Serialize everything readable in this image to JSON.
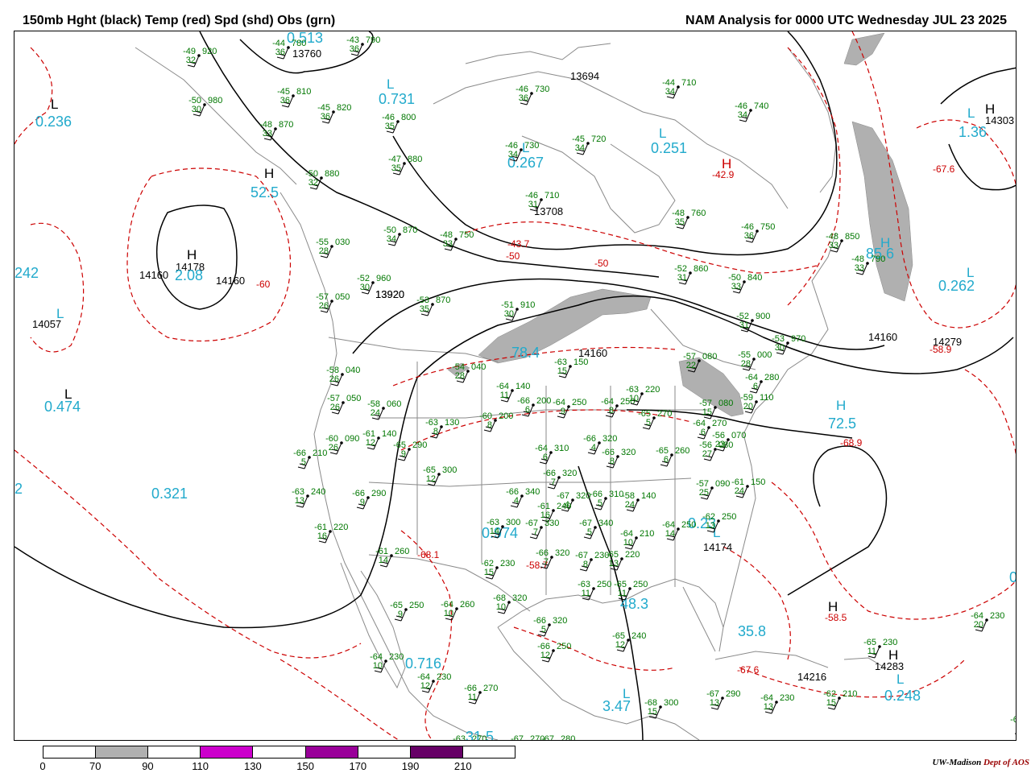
{
  "header": {
    "left_title": "150mb Hght (black) Temp (red) Spd (shd) Obs (grn)",
    "right_title": "NAM Analysis for 0000 UTC Wednesday  JUL 23 2025"
  },
  "colors": {
    "height": "#000000",
    "temp": "#cc0000",
    "speed_label": "#22aacc",
    "obs": "#007700",
    "geo": "#888888",
    "shade": "#b0b0b0"
  },
  "height_labels": [
    "13760",
    "13694",
    "14303",
    "13708",
    "14160",
    "14178",
    "14160",
    "14057",
    "13920",
    "13920",
    "14160",
    "14160",
    "14279",
    "14174",
    "14216",
    "14283"
  ],
  "pressure_systems": {
    "highs": [
      "H",
      "H",
      "H",
      "H",
      "H",
      "H",
      "H",
      "H"
    ],
    "lows": [
      "L",
      "L",
      "L",
      "L",
      "L",
      "L",
      "L",
      "L",
      "L",
      "L",
      "L"
    ]
  },
  "speed_labels": [
    "0.236",
    "0.731",
    "0.513",
    "0.251",
    "1.36",
    "0.267",
    "52.5",
    "2.08",
    "242",
    "0.262",
    "85.6",
    "0.474",
    "78.4",
    "72.5",
    "0.321",
    "0.974",
    "0.23",
    "48.3",
    "35.8",
    "0.716",
    "3.47",
    "31.5",
    "0.248",
    "2",
    "0"
  ],
  "temp_labels": [
    "-42.9",
    "-67.6",
    "-43.7",
    "-50",
    "-50",
    "-58.9",
    "-60",
    "-68.9",
    "-68.1",
    "-58.7",
    "-58.5",
    "-67.6"
  ],
  "stations": [
    {
      "t": "-49",
      "h": "920",
      "d": "32"
    },
    {
      "t": "-44",
      "h": "780",
      "d": "36"
    },
    {
      "t": "-43",
      "h": "790",
      "d": "36"
    },
    {
      "t": "-45",
      "h": "810",
      "d": "36"
    },
    {
      "t": "-50",
      "h": "980",
      "d": "30"
    },
    {
      "t": "-45",
      "h": "820",
      "d": "36"
    },
    {
      "t": "-48",
      "h": "870",
      "d": "33"
    },
    {
      "t": "-46",
      "h": "800",
      "d": "35"
    },
    {
      "t": "-46",
      "h": "730",
      "d": "36"
    },
    {
      "t": "-44",
      "h": "710",
      "d": "34"
    },
    {
      "t": "-46",
      "h": "740",
      "d": "34"
    },
    {
      "t": "-46",
      "h": "730",
      "d": "34"
    },
    {
      "t": "-45",
      "h": "720",
      "d": "34"
    },
    {
      "t": "-47",
      "h": "880",
      "d": "35"
    },
    {
      "t": "-50",
      "h": "880",
      "d": "32"
    },
    {
      "t": "-46",
      "h": "710",
      "d": "31"
    },
    {
      "t": "-48",
      "h": "760",
      "d": "35"
    },
    {
      "t": "-46",
      "h": "750",
      "d": "36"
    },
    {
      "t": "-48",
      "h": "850",
      "d": "33"
    },
    {
      "t": "-50",
      "h": "870",
      "d": "34"
    },
    {
      "t": "-48",
      "h": "750",
      "d": "33"
    },
    {
      "t": "-48",
      "h": "790",
      "d": "33"
    },
    {
      "t": "-55",
      "h": "030",
      "d": "28"
    },
    {
      "t": "-52",
      "h": "960",
      "d": "30"
    },
    {
      "t": "-53",
      "h": "870",
      "d": "35"
    },
    {
      "t": "-52",
      "h": "860",
      "d": "31"
    },
    {
      "t": "-50",
      "h": "840",
      "d": "33"
    },
    {
      "t": "-57",
      "h": "050",
      "d": "26"
    },
    {
      "t": "-51",
      "h": "910",
      "d": "30"
    },
    {
      "t": "-52",
      "h": "900",
      "d": "31"
    },
    {
      "t": "-53",
      "h": "970",
      "d": "30"
    },
    {
      "t": "-58",
      "h": "040",
      "d": "26"
    },
    {
      "t": "-54",
      "h": "040",
      "d": "28"
    },
    {
      "t": "-63",
      "h": "150",
      "d": "15"
    },
    {
      "t": "-57",
      "h": "080",
      "d": "22"
    },
    {
      "t": "-55",
      "h": "000",
      "d": "28"
    },
    {
      "t": "-57",
      "h": "050",
      "d": "26"
    },
    {
      "t": "-58",
      "h": "060",
      "d": "24"
    },
    {
      "t": "-64",
      "h": "140",
      "d": "11"
    },
    {
      "t": "-66",
      "h": "200",
      "d": "6"
    },
    {
      "t": "-64",
      "h": "250",
      "d": "9"
    },
    {
      "t": "-64",
      "h": "250",
      "d": "8"
    },
    {
      "t": "-63",
      "h": "220",
      "d": "10"
    },
    {
      "t": "-64",
      "h": "280",
      "d": "6"
    },
    {
      "t": "-57",
      "h": "080",
      "d": "15"
    },
    {
      "t": "-59",
      "h": "110",
      "d": "20"
    },
    {
      "t": "-63",
      "h": "130",
      "d": "8"
    },
    {
      "t": "-60",
      "h": "200",
      "d": "8"
    },
    {
      "t": "-65",
      "h": "270",
      "d": "5"
    },
    {
      "t": "-64",
      "h": "270",
      "d": "6"
    },
    {
      "t": "-56",
      "h": "070",
      "d": "23"
    },
    {
      "t": "-60",
      "h": "090",
      "d": "26"
    },
    {
      "t": "-61",
      "h": "140",
      "d": "12"
    },
    {
      "t": "-65",
      "h": "290",
      "d": "9"
    },
    {
      "t": "-64",
      "h": "310",
      "d": "6"
    },
    {
      "t": "-66",
      "h": "320",
      "d": "4"
    },
    {
      "t": "-66",
      "h": "320",
      "d": "8"
    },
    {
      "t": "-65",
      "h": "260",
      "d": "6"
    },
    {
      "t": "-56",
      "h": "080",
      "d": "27"
    },
    {
      "t": "-66",
      "h": "210",
      "d": "5"
    },
    {
      "t": "-65",
      "h": "300",
      "d": "12"
    },
    {
      "t": "-66",
      "h": "320",
      "d": "7"
    },
    {
      "t": "-66",
      "h": "310",
      "d": "5"
    },
    {
      "t": "-57",
      "h": "090",
      "d": "25"
    },
    {
      "t": "-61",
      "h": "150",
      "d": "24"
    },
    {
      "t": "-63",
      "h": "240",
      "d": "13"
    },
    {
      "t": "-66",
      "h": "290",
      "d": "9"
    },
    {
      "t": "-66",
      "h": "340",
      "d": "4"
    },
    {
      "t": "-67",
      "h": "320",
      "d": "4"
    },
    {
      "t": "-58",
      "h": "140",
      "d": "24"
    },
    {
      "t": "-62",
      "h": "250",
      "d": "13"
    },
    {
      "t": "-61",
      "h": "220",
      "d": "16"
    },
    {
      "t": "-61",
      "h": "240",
      "d": "16"
    },
    {
      "t": "-63",
      "h": "300",
      "d": "14"
    },
    {
      "t": "-67",
      "h": "330",
      "d": "7"
    },
    {
      "t": "-67",
      "h": "340",
      "d": "5"
    },
    {
      "t": "-64",
      "h": "210",
      "d": "10"
    },
    {
      "t": "-64",
      "h": "250",
      "d": "14"
    },
    {
      "t": "-61",
      "h": "260",
      "d": "14"
    },
    {
      "t": "-66",
      "h": "320",
      "d": "7"
    },
    {
      "t": "-67",
      "h": "230",
      "d": "8"
    },
    {
      "t": "-65",
      "h": "220",
      "d": "13"
    },
    {
      "t": "-62",
      "h": "230",
      "d": "15"
    },
    {
      "t": "-65",
      "h": "250",
      "d": "9"
    },
    {
      "t": "-64",
      "h": "260",
      "d": "10"
    },
    {
      "t": "-68",
      "h": "320",
      "d": "10"
    },
    {
      "t": "-66",
      "h": "320",
      "d": "5"
    },
    {
      "t": "-63",
      "h": "250",
      "d": "11"
    },
    {
      "t": "-65",
      "h": "250",
      "d": "11"
    },
    {
      "t": "-66",
      "h": "250",
      "d": "12"
    },
    {
      "t": "-65",
      "h": "240",
      "d": "12"
    },
    {
      "t": "-64",
      "h": "230",
      "d": "20"
    },
    {
      "t": "-64",
      "h": "230",
      "d": "10"
    },
    {
      "t": "-64",
      "h": "230",
      "d": "12"
    },
    {
      "t": "-65",
      "h": "230",
      "d": "11"
    },
    {
      "t": "-66",
      "h": "270",
      "d": "11"
    },
    {
      "t": "-68",
      "h": "300",
      "d": "15"
    },
    {
      "t": "-67",
      "h": "290",
      "d": "13"
    },
    {
      "t": "-64",
      "h": "230",
      "d": "13"
    },
    {
      "t": "-62",
      "h": "210",
      "d": "15"
    },
    {
      "t": "-67",
      "h": "290",
      "d": "8"
    },
    {
      "t": "-63",
      "h": "270",
      "d": "9"
    },
    {
      "t": "-67",
      "h": "270",
      "d": "6"
    },
    {
      "t": "-67",
      "h": "280",
      "d": "8"
    }
  ],
  "colorbar": {
    "labels": [
      "0",
      "70",
      "90",
      "110",
      "130",
      "150",
      "170",
      "190",
      "210"
    ],
    "segments": [
      "#ffffff",
      "#b0b0b0",
      "#ffffff",
      "#cc00cc",
      "#ffffff",
      "#990099",
      "#ffffff",
      "#660066",
      "#ffffff"
    ]
  },
  "credit": {
    "org": "UW-Madison",
    "dept": "Dept of AOS"
  }
}
